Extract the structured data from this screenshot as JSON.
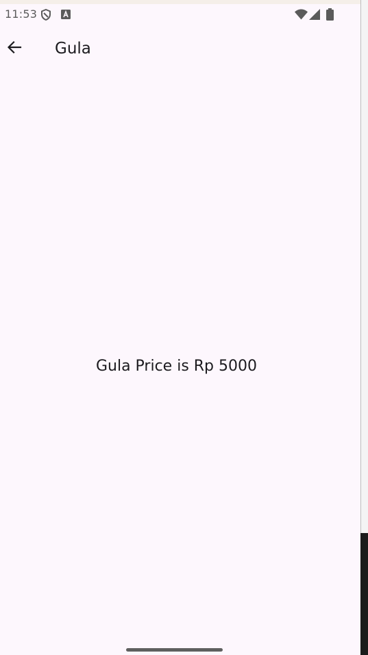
{
  "status_bar": {
    "time": "11:53",
    "icons": {
      "left": [
        "shield-icon",
        "text-a-notification-icon"
      ],
      "right": [
        "wifi-icon",
        "cell-signal-icon",
        "battery-icon"
      ]
    }
  },
  "app_bar": {
    "back_icon": "arrow-back-icon",
    "title": "Gula"
  },
  "content": {
    "message": "Gula Price is Rp 5000"
  },
  "colors": {
    "background": "#fdf7fd",
    "text": "#1c1b1f",
    "status_text": "#5b5b5b"
  }
}
